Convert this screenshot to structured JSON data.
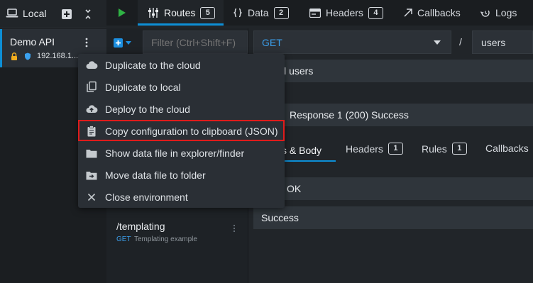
{
  "environments": {
    "header_label": "Local",
    "active": {
      "name": "Demo API",
      "host": "192.168.1...."
    }
  },
  "nav": {
    "tabs": [
      {
        "label": "Routes",
        "badge": "5"
      },
      {
        "label": "Data",
        "badge": "2"
      },
      {
        "label": "Headers",
        "badge": "4"
      },
      {
        "label": "Callbacks"
      },
      {
        "label": "Logs"
      }
    ]
  },
  "routes_panel": {
    "filter_placeholder": "Filter (Ctrl+Shift+F)",
    "routes": [
      {
        "path": "/templating",
        "method": "GET",
        "description": "Templating example"
      }
    ]
  },
  "route_editor": {
    "method": "GET",
    "separator": "/",
    "path": "users",
    "doc_partial": "ll users",
    "response_label": "Response 1 (200)",
    "response_status_text": "Success",
    "sub_tabs": [
      {
        "label": "s & Body"
      },
      {
        "label": "Headers",
        "badge": "1"
      },
      {
        "label": "Rules",
        "badge": "1"
      },
      {
        "label": "Callbacks"
      }
    ],
    "status_partial": "OK",
    "body_description": "Success"
  },
  "context_menu": {
    "items": [
      {
        "label": "Duplicate to the cloud",
        "icon": "cloud-icon"
      },
      {
        "label": "Duplicate to local",
        "icon": "copy-icon"
      },
      {
        "label": "Deploy to the cloud",
        "icon": "cloud-upload-icon"
      },
      {
        "label": "Copy configuration to clipboard (JSON)",
        "icon": "clipboard-icon",
        "highlighted": true
      },
      {
        "label": "Show data file in explorer/finder",
        "icon": "folder-icon"
      },
      {
        "label": "Move data file to folder",
        "icon": "folder-move-icon"
      },
      {
        "label": "Close environment",
        "icon": "close-icon"
      }
    ]
  },
  "colors": {
    "accent": "#0d8fd6",
    "play": "#2fb344",
    "highlight_border": "#e01b1b",
    "lock": "#f0ad1e",
    "method_get": "#3b9eea"
  }
}
